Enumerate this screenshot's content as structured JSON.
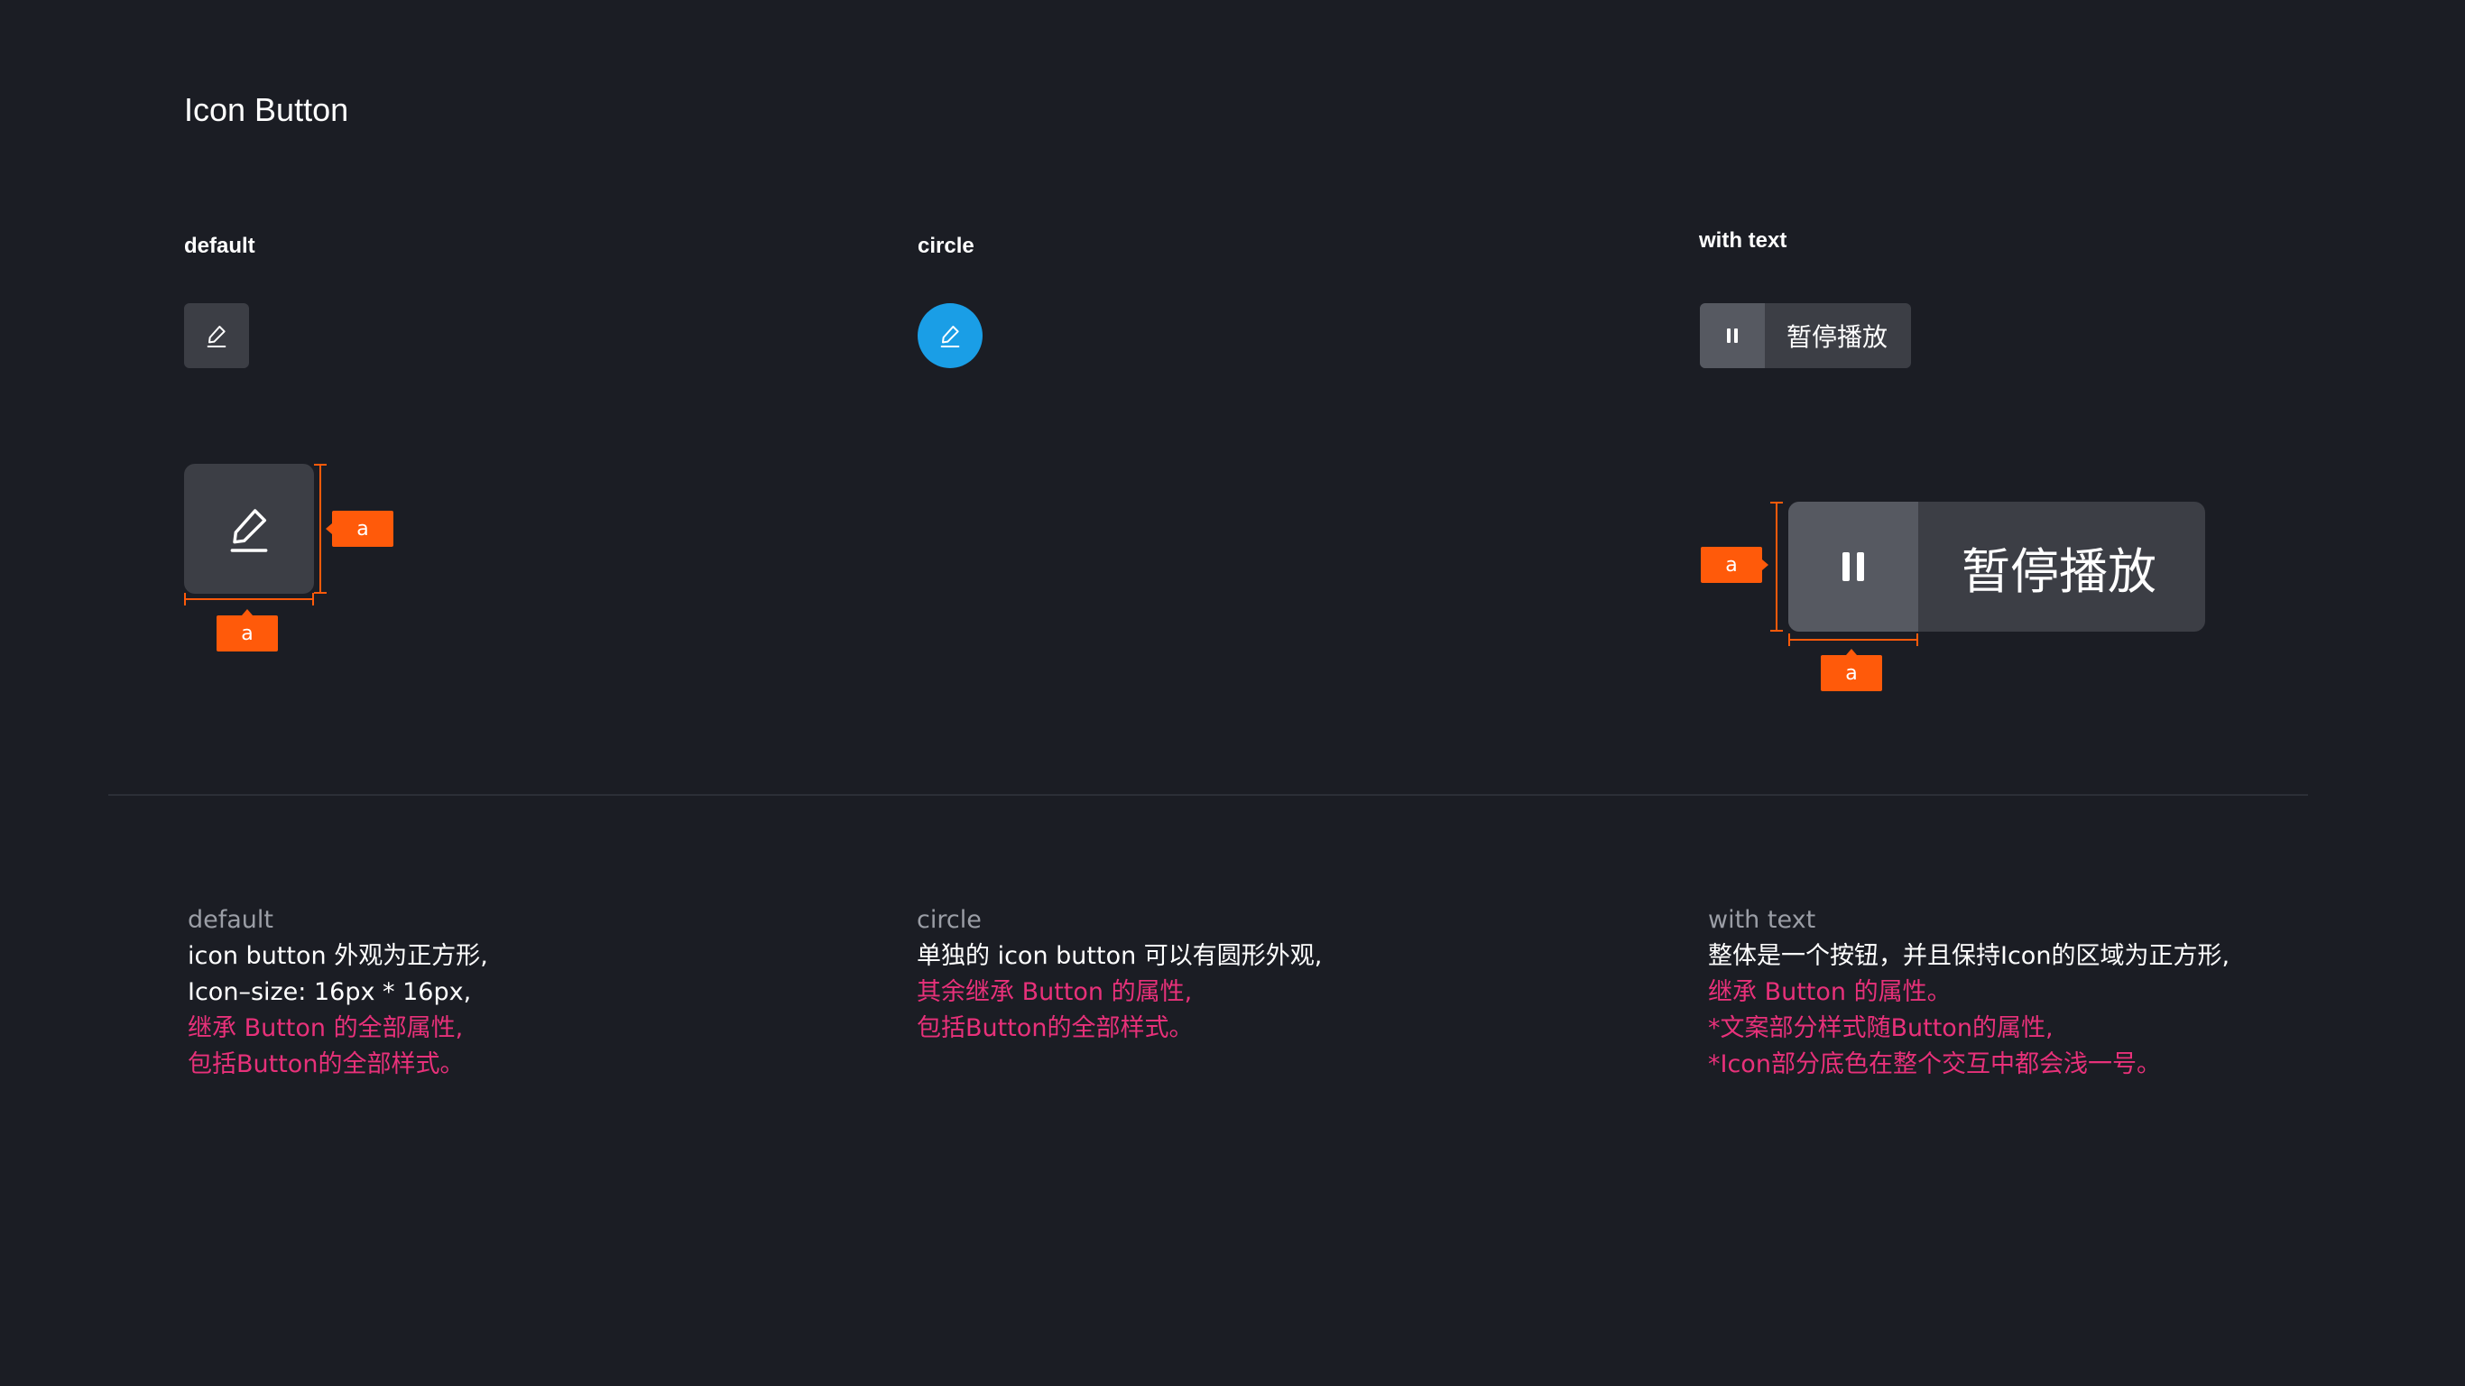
{
  "page_title": "Icon Button",
  "sections": {
    "default": {
      "label": "default"
    },
    "circle": {
      "label": "circle"
    },
    "with_text": {
      "label": "with text",
      "button_text": "暂停播放"
    }
  },
  "annotation": {
    "tag": "a"
  },
  "icons": {
    "edit": "pencil-edit-icon",
    "pause": "pause-icon"
  },
  "colors": {
    "background": "#1b1d24",
    "button_bg": "#3c3e45",
    "button_icon_area": "#565961",
    "circle_bg": "#1a9ee6",
    "annotation": "#ff5a0a",
    "highlight_text": "#e8317a",
    "secondary_text": "#9b9ea6"
  },
  "descriptions": {
    "default": {
      "title": "default",
      "lines": [
        {
          "text": "icon button 外观为正方形,",
          "style": "white"
        },
        {
          "text": "Icon–size: 16px * 16px,",
          "style": "white"
        },
        {
          "text": "继承 Button 的全部属性,",
          "style": "pink"
        },
        {
          "text": "包括Button的全部样式。",
          "style": "pink"
        }
      ]
    },
    "circle": {
      "title": "circle",
      "lines": [
        {
          "text": "单独的 icon button 可以有圆形外观,",
          "style": "white"
        },
        {
          "text": "其余继承 Button 的属性,",
          "style": "pink"
        },
        {
          "text": "包括Button的全部样式。",
          "style": "pink"
        }
      ]
    },
    "with_text": {
      "title": "with text",
      "lines": [
        {
          "text": "整体是一个按钮，并且保持Icon的区域为正方形,",
          "style": "white"
        },
        {
          "text": "继承 Button 的属性。",
          "style": "pink"
        },
        {
          "text": "*文案部分样式随Button的属性,",
          "style": "pink"
        },
        {
          "text": "*Icon部分底色在整个交互中都会浅一号。",
          "style": "pink"
        }
      ]
    }
  }
}
